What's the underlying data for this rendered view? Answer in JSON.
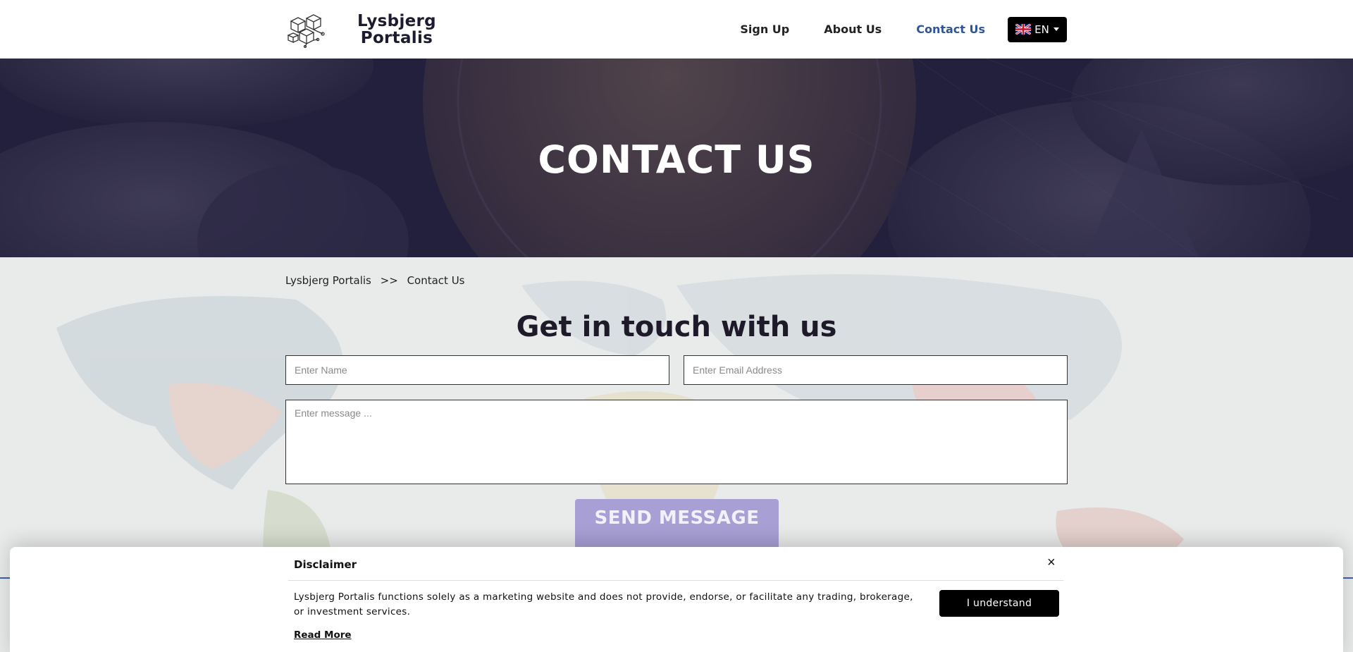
{
  "brand": {
    "name_line1": "Lysbjerg",
    "name_line2": "Portalis"
  },
  "nav": {
    "items": [
      {
        "label": "Sign Up"
      },
      {
        "label": "About Us"
      },
      {
        "label": "Contact Us",
        "active": true
      }
    ],
    "language": {
      "code": "EN",
      "flag": "uk-flag-icon"
    }
  },
  "hero": {
    "title": "CONTACT US"
  },
  "breadcrumb": {
    "home": "Lysbjerg Portalis",
    "separator": ">>",
    "current": "Contact Us"
  },
  "contact_form": {
    "title": "Get in touch with us",
    "name_placeholder": "Enter Name",
    "email_placeholder": "Enter Email Address",
    "message_placeholder": "Enter message ...",
    "submit_label": "SEND MESSAGE"
  },
  "disclaimer": {
    "title": "Disclaimer",
    "close": "×",
    "text": "Lysbjerg Portalis functions solely as a marketing website and does not provide, endorse, or facilitate any trading, brokerage, or investment services.",
    "read_more": "Read More",
    "button_label": "I understand"
  },
  "colors": {
    "nav_active": "#2f5597",
    "hero_overlay": "#1f1d36",
    "send_button": "#a89fd4",
    "accent_line": "#3b5fbe"
  }
}
